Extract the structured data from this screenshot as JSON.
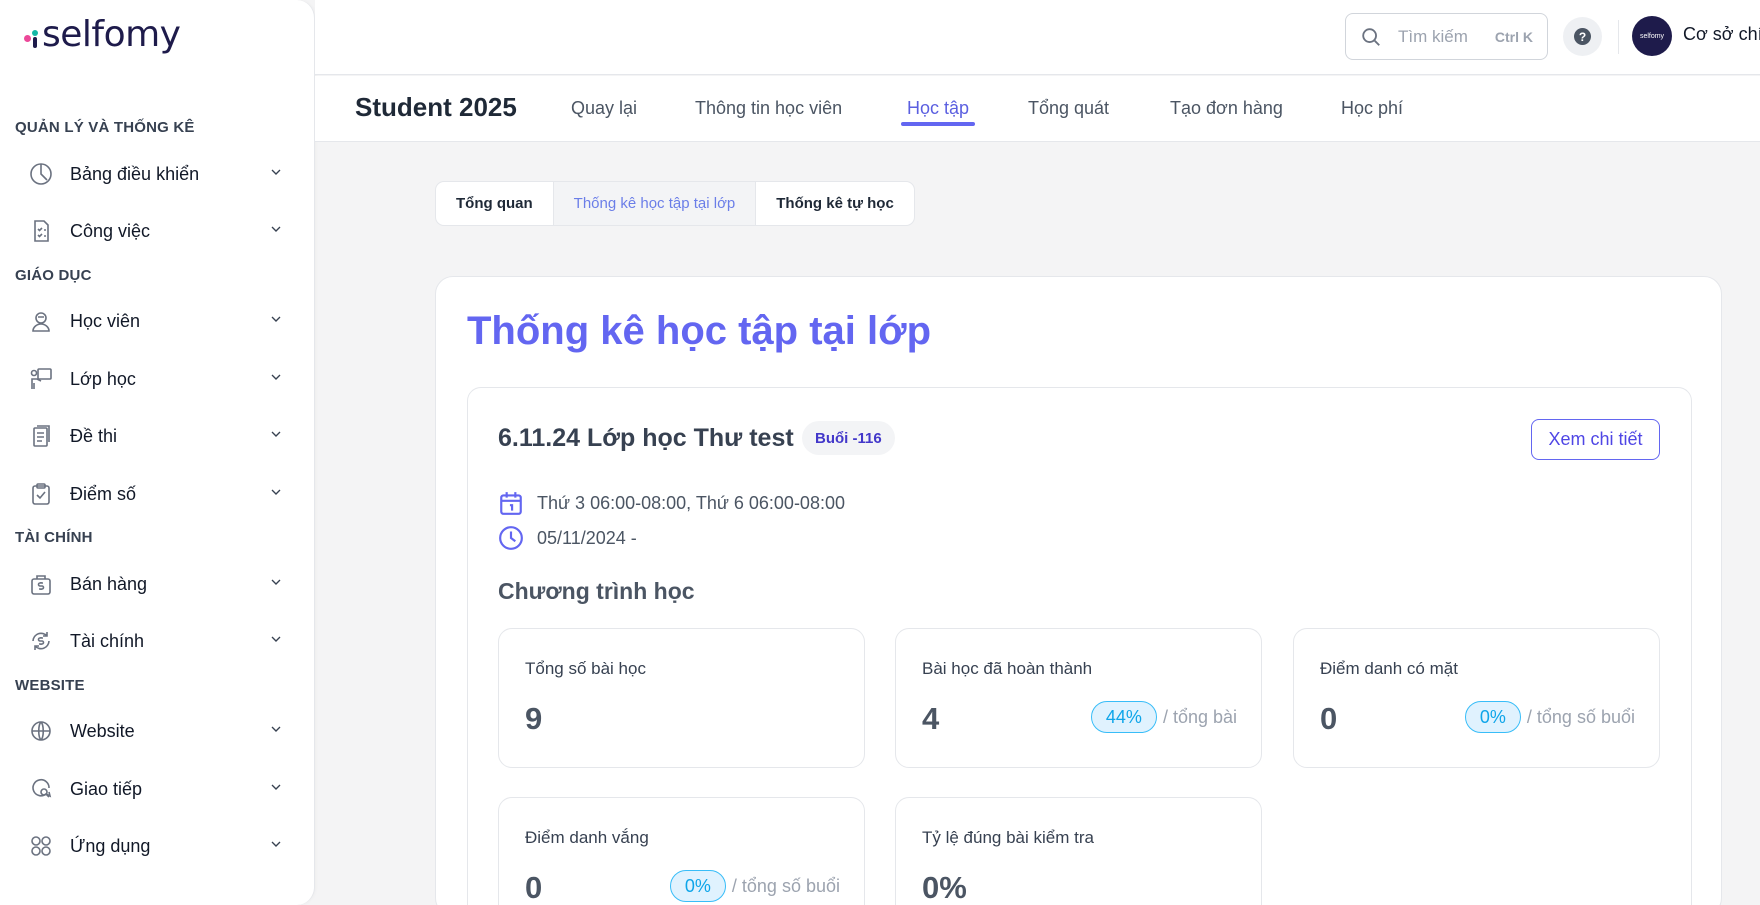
{
  "brand": {
    "name": "selfomy"
  },
  "sidebar": {
    "sections": [
      {
        "title": "QUẢN LÝ VÀ THỐNG KÊ"
      },
      {
        "title": "GIÁO DỤC"
      },
      {
        "title": "TÀI CHÍNH"
      },
      {
        "title": "WEBSITE"
      }
    ],
    "items": [
      {
        "label": "Bảng điều khiển",
        "icon": "clock-pie-icon"
      },
      {
        "label": "Công việc",
        "icon": "task-list-icon"
      },
      {
        "label": "Học viên",
        "icon": "student-icon"
      },
      {
        "label": "Lớp học",
        "icon": "teacher-board-icon"
      },
      {
        "label": "Đề thi",
        "icon": "exam-doc-icon"
      },
      {
        "label": "Điểm số",
        "icon": "clipboard-check-icon"
      },
      {
        "label": "Bán hàng",
        "icon": "sales-bag-icon"
      },
      {
        "label": "Tài chính",
        "icon": "finance-cycle-icon"
      },
      {
        "label": "Website",
        "icon": "globe-icon"
      },
      {
        "label": "Giao tiếp",
        "icon": "chat-search-icon"
      },
      {
        "label": "Ứng dụng",
        "icon": "apps-grid-icon"
      }
    ]
  },
  "header": {
    "search_placeholder": "Tìm kiếm",
    "search_shortcut": "Ctrl K",
    "help": "?",
    "avatar_text": "selfomy",
    "branch": "Cơ sở chính"
  },
  "profile": {
    "student_name": "Student 2025",
    "tabs": [
      {
        "label": "Quay lại"
      },
      {
        "label": "Thông tin học viên"
      },
      {
        "label": "Học tập"
      },
      {
        "label": "Tổng quát"
      },
      {
        "label": "Tạo đơn hàng"
      },
      {
        "label": "Học phí"
      }
    ],
    "active_tab": "Học tập"
  },
  "segments": [
    {
      "label": "Tổng quan"
    },
    {
      "label": "Thống kê học tập tại lớp"
    },
    {
      "label": "Thống kê tự học"
    }
  ],
  "main": {
    "title": "Thống kê học tập tại lớp",
    "class": {
      "name": "6.11.24 Lớp học Thư test",
      "badge": "Buổi -116",
      "detail_button": "Xem chi tiết",
      "schedule": "Thứ 3 06:00-08:00, Thứ 6 06:00-08:00",
      "dates": "05/11/2024 -",
      "program_title": "Chương trình học",
      "stats": [
        {
          "label": "Tổng số bài học",
          "value": "9",
          "pct": "",
          "suffix": ""
        },
        {
          "label": "Bài học đã hoàn thành",
          "value": "4",
          "pct": "44%",
          "suffix": "/ tổng bài"
        },
        {
          "label": "Điểm danh có mặt",
          "value": "0",
          "pct": "0%",
          "suffix": "/ tổng số buổi"
        },
        {
          "label": "Điểm danh vắng",
          "value": "0",
          "pct": "0%",
          "suffix": "/ tổng số buổi"
        },
        {
          "label": "Tỷ lệ đúng bài kiểm tra",
          "value": "0%",
          "pct": "",
          "suffix": ""
        }
      ]
    }
  },
  "colors": {
    "accent": "#6366f1",
    "pill": "#0ea5e9"
  }
}
